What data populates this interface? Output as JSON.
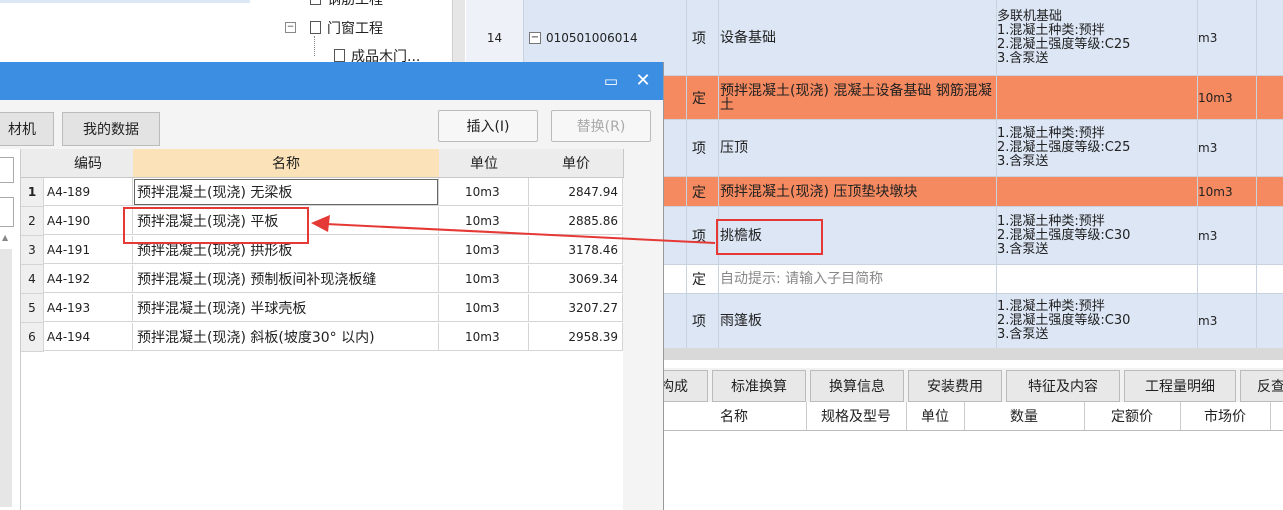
{
  "tree": {
    "items": [
      {
        "label": "钢筋工程"
      },
      {
        "label": "门窗工程"
      },
      {
        "label": "成品木门..."
      }
    ]
  },
  "quota_grid": {
    "rows": [
      {
        "num": "14",
        "code": "010501006014",
        "type": "项",
        "name": "设备基础",
        "features": [
          "多联机基础",
          "1.混凝土种类:预拌",
          "2.混凝土强度等级:C25",
          "3.含泵送"
        ],
        "unit": "m3",
        "kind": "item"
      },
      {
        "num": "",
        "code": "",
        "type": "定",
        "name": "预拌混凝土(现浇) 混凝土设备基础 钢筋混凝土",
        "features": [],
        "unit": "10m3",
        "kind": "quota"
      },
      {
        "num": "",
        "code": "",
        "type": "项",
        "name": "压顶",
        "features": [
          "1.混凝土种类:预拌",
          "2.混凝土强度等级:C25",
          "3.含泵送"
        ],
        "unit": "m3",
        "kind": "item"
      },
      {
        "num": "",
        "code": "",
        "type": "定",
        "name": "预拌混凝土(现浇) 压顶垫块墩块",
        "features": [],
        "unit": "10m3",
        "kind": "quota"
      },
      {
        "num": "",
        "code": "",
        "type": "项",
        "name": "挑檐板",
        "features": [
          "1.混凝土种类:预拌",
          "2.混凝土强度等级:C30",
          "3.含泵送"
        ],
        "unit": "m3",
        "kind": "item"
      },
      {
        "num": "",
        "code": "",
        "type": "定",
        "name": "自动提示: 请输入子目简称",
        "features": [],
        "unit": "",
        "kind": "plain"
      },
      {
        "num": "",
        "code": "",
        "type": "项",
        "name": "雨篷板",
        "features": [
          "1.混凝土种类:预拌",
          "2.混凝土强度等级:C30",
          "3.含泵送"
        ],
        "unit": "m3",
        "kind": "item"
      }
    ]
  },
  "bottom_tabs": [
    "构成",
    "标准换算",
    "换算信息",
    "安装费用",
    "特征及内容",
    "工程量明细",
    "反查"
  ],
  "bottom_headers": [
    "名称",
    "规格及型号",
    "单位",
    "数量",
    "定额价",
    "市场价"
  ],
  "dialog": {
    "tabs": [
      "材机",
      "我的数据"
    ],
    "insert_label": "插入(I)",
    "replace_label": "替换(R)",
    "restore_glyph": "▭",
    "close_glyph": "✕",
    "columns": {
      "code": "编码",
      "name": "名称",
      "unit": "单位",
      "price": "单价"
    },
    "rows": [
      {
        "idx": "1",
        "code": "A4-189",
        "name": "预拌混凝土(现浇) 无梁板",
        "unit": "10m3",
        "price": "2847.94"
      },
      {
        "idx": "2",
        "code": "A4-190",
        "name": "预拌混凝土(现浇) 平板",
        "unit": "10m3",
        "price": "2885.86"
      },
      {
        "idx": "3",
        "code": "A4-191",
        "name": "预拌混凝土(现浇) 拱形板",
        "unit": "10m3",
        "price": "3178.46"
      },
      {
        "idx": "4",
        "code": "A4-192",
        "name": "预拌混凝土(现浇) 预制板间补现浇板缝",
        "unit": "10m3",
        "price": "3069.34"
      },
      {
        "idx": "5",
        "code": "A4-193",
        "name": "预拌混凝土(现浇) 半球壳板",
        "unit": "10m3",
        "price": "3207.27"
      },
      {
        "idx": "6",
        "code": "A4-194",
        "name": "预拌混凝土(现浇) 斜板(坡度30° 以内)",
        "unit": "10m3",
        "price": "2958.39"
      }
    ]
  },
  "colors": {
    "dialog_title": "#3c8ee3",
    "item_row": "#dce6f5",
    "quota_row": "#f5895f",
    "annotation": "#e53935"
  }
}
